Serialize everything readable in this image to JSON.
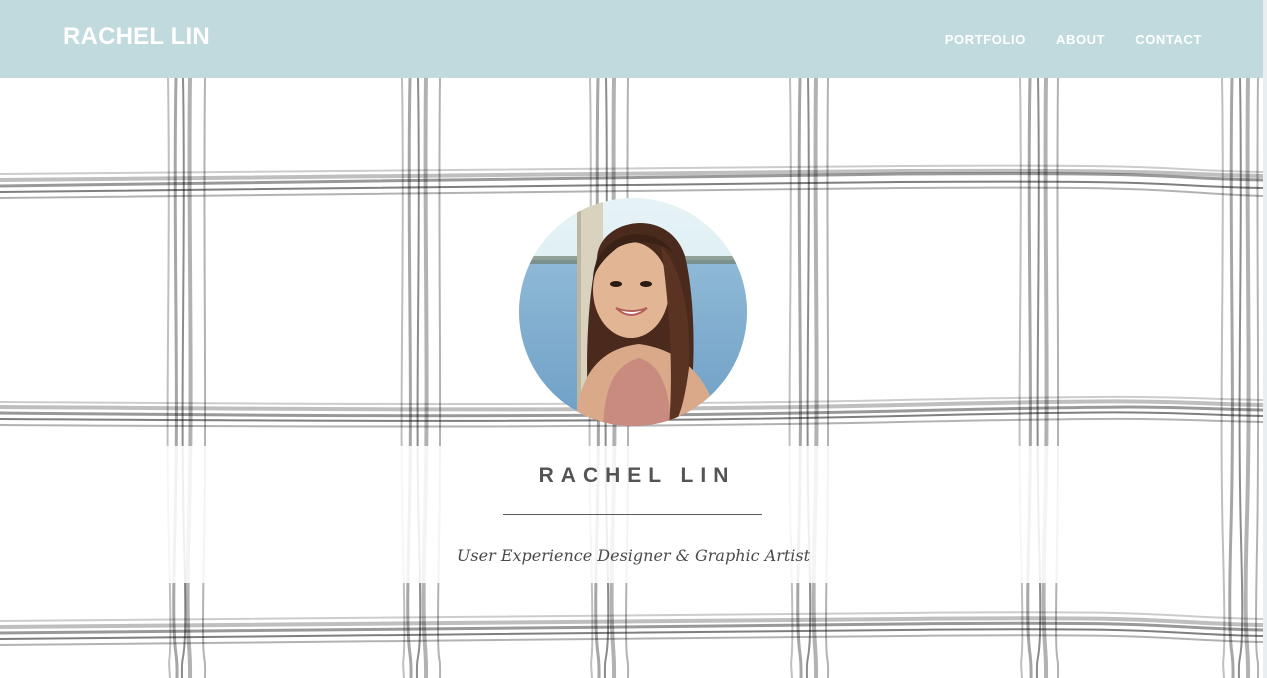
{
  "header": {
    "brand": "RACHEL LIN",
    "nav": [
      "PORTFOLIO",
      "ABOUT",
      "CONTACT"
    ]
  },
  "hero": {
    "name": "RACHEL LIN",
    "tagline": "User Experience Designer & Graphic Artist"
  },
  "colors": {
    "header_bg": "#c0dade",
    "grid_stroke": "#000000",
    "text_dark": "#545454"
  }
}
